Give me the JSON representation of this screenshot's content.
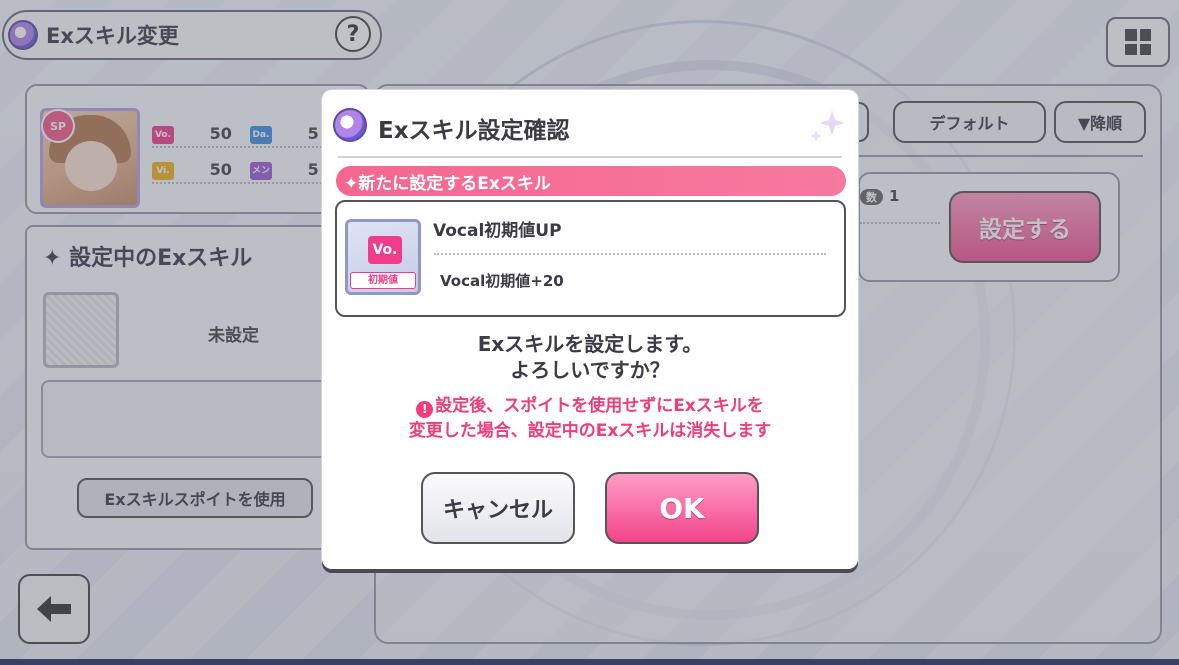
{
  "header": {
    "title": "Exスキル変更",
    "help_label": "?"
  },
  "idol_card": {
    "badge": "SP",
    "stats": [
      {
        "tag": "Vo.",
        "value": "50",
        "color": "#ef3d8b"
      },
      {
        "tag": "Da.",
        "value": "5",
        "color": "#3f8fe0"
      },
      {
        "tag": "Vi.",
        "value": "50",
        "color": "#f0b21a"
      },
      {
        "tag": "メン",
        "value": "5",
        "color": "#9b5bd6"
      }
    ]
  },
  "left_panel": {
    "title": "✦ 設定中のExスキル",
    "unset_label": "未設定",
    "dropper_button": "Exスキルスポイトを使用"
  },
  "right_panel": {
    "default_button": "デフォルト",
    "order_button": "▼降順",
    "count_badge": "数",
    "count_value": "1",
    "set_button": "設定する"
  },
  "modal": {
    "title": "Exスキル設定確認",
    "section_label": "✦新たに設定するExスキル",
    "skill": {
      "icon_tag": "Vo.",
      "icon_sub": "初期値",
      "name": "Vocal初期値UP",
      "effect": "Vocal初期値+20"
    },
    "confirm_line1": "Exスキルを設定します。",
    "confirm_line2": "よろしいですか？",
    "warning_icon": "!",
    "warning_line1": "設定後、スポイトを使用せずにExスキルを",
    "warning_line2": "変更した場合、設定中のExスキルは消失します",
    "cancel_button": "キャンセル",
    "ok_button": "OK"
  },
  "colors": {
    "accent_pink": "#f2458a",
    "warning_pink": "#ef3d7b",
    "section_bar": "#f46790"
  }
}
